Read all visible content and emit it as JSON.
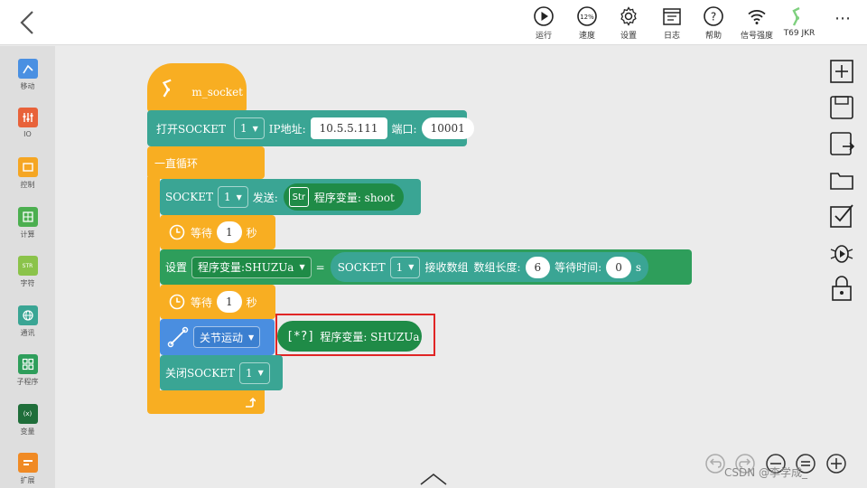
{
  "topbar": {
    "tools": [
      {
        "label": "运行",
        "icon": "play-icon"
      },
      {
        "label": "速度",
        "icon": "speed-icon",
        "value": "12%"
      },
      {
        "label": "设置",
        "icon": "gear-icon"
      },
      {
        "label": "日志",
        "icon": "log-icon"
      },
      {
        "label": "帮助",
        "icon": "help-icon"
      },
      {
        "label": "信号强度",
        "icon": "wifi-icon"
      },
      {
        "label": "T69 JKR",
        "icon": "robot-arm-icon"
      }
    ],
    "more": "⋯"
  },
  "sidebar": {
    "items": [
      {
        "label": "移动",
        "color": "#4a90e2"
      },
      {
        "label": "IO",
        "color": "#e8623a"
      },
      {
        "label": "控制",
        "color": "#f5a623"
      },
      {
        "label": "计算",
        "color": "#4caf50"
      },
      {
        "label": "字符",
        "color": "#8bc34a"
      },
      {
        "label": "通讯",
        "color": "#3aa594"
      },
      {
        "label": "子程序",
        "color": "#2e9e5b"
      },
      {
        "label": "变量",
        "color": "#1f6e3a"
      },
      {
        "label": "扩展",
        "color": "#f08a24"
      }
    ]
  },
  "program": {
    "start": {
      "label": "m_socket"
    },
    "open_socket": {
      "label": "打开SOCKET",
      "socket_id": "1",
      "ip_label": "IP地址:",
      "ip": "10.5.5.111",
      "port_label": "端口:",
      "port": "10001"
    },
    "loop": {
      "label": "一直循环"
    },
    "send": {
      "label": "SOCKET",
      "socket_id": "1",
      "send_label": "发送:",
      "icon": "Str",
      "var": "程序变量: shoot"
    },
    "wait1": {
      "label": "等待",
      "value": "1",
      "unit": "秒"
    },
    "set": {
      "label": "设置",
      "var": "程序变量:SHUZUa",
      "eq": "=",
      "socket_label": "SOCKET",
      "socket_id": "1",
      "recv_label": "接收数组",
      "len_label": "数组长度:",
      "len": "6",
      "time_label": "等待时间:",
      "time": "0",
      "time_unit": "s"
    },
    "wait2": {
      "label": "等待",
      "value": "1",
      "unit": "秒"
    },
    "joint": {
      "label": "关节运动",
      "icon": "[*?]",
      "var": "程序变量: SHUZUa"
    },
    "close": {
      "label": "关闭SOCKET",
      "socket_id": "1"
    }
  },
  "watermark": "CSDN @李学成_"
}
